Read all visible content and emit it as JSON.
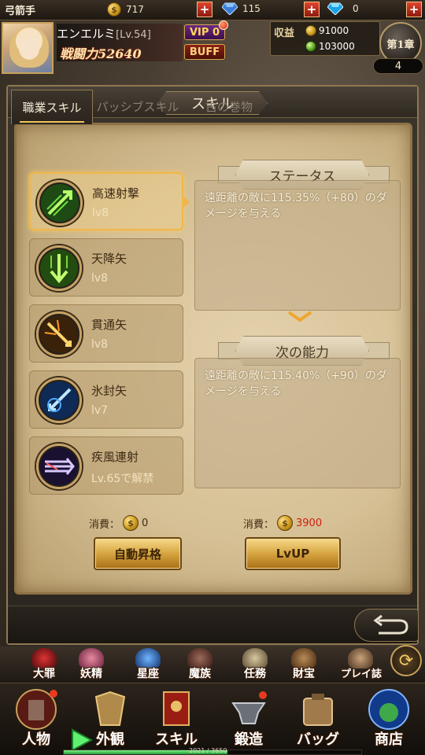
{
  "topbar": {
    "class_name": "弓箭手",
    "gold": "717",
    "diamond_blue": "115",
    "diamond_sky": "0"
  },
  "player": {
    "name": "エンエルミ",
    "level": "[Lv.54]",
    "power": "戦闘力52640",
    "vip": "VIP 0",
    "buff": "BUFF"
  },
  "income": {
    "label": "収益",
    "gold": "91000",
    "green": "103000"
  },
  "chapter": {
    "label": "第1章",
    "stage": "4"
  },
  "panel": {
    "title": "スキル"
  },
  "skills": [
    {
      "name": "高速射撃",
      "level": "lv8",
      "selected": true
    },
    {
      "name": "天降矢",
      "level": "lv8",
      "selected": false
    },
    {
      "name": "貫通矢",
      "level": "lv8",
      "selected": false
    },
    {
      "name": "氷封矢",
      "level": "lv7",
      "selected": false
    },
    {
      "name": "疾風連射",
      "level": "Lv.65で解禁",
      "selected": false
    }
  ],
  "status": {
    "title": "ステータス",
    "desc": "遠距離の敵に115.35%（+80）のダメージを与える"
  },
  "next": {
    "title": "次の能力",
    "desc": "遠距離の敵に115.40%（+90）のダメージを与える"
  },
  "actions": {
    "cost_label": "消費：",
    "auto_cost": "0",
    "lvup_cost": "3900",
    "auto_button": "自動昇格",
    "lvup_button": "LvUP"
  },
  "tabs": [
    {
      "label": "職業スキル",
      "active": true
    },
    {
      "label": "パッシブスキル",
      "active": false
    },
    {
      "label": "古の巻物",
      "active": false
    }
  ],
  "nav_small": [
    "大罪",
    "妖精",
    "星座",
    "魔族",
    "任務",
    "財宝",
    "プレイ誌"
  ],
  "nav_big": [
    "人物",
    "外観",
    "スキル",
    "鍛造",
    "バッグ",
    "商店"
  ],
  "exp": {
    "text": "2021 / 3650",
    "fraction": 0.55
  },
  "icons": [
    "gold-coin-icon",
    "blue-gem-icon",
    "sky-gem-icon",
    "plus-icon",
    "back-arrow-icon",
    "refresh-icon"
  ]
}
